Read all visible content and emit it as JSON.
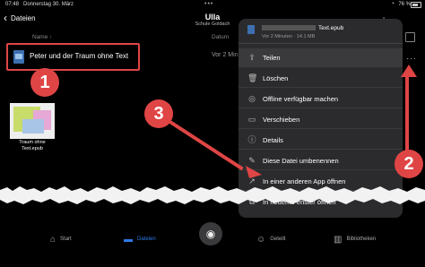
{
  "status": {
    "time": "07:48",
    "date": "Donnerstag 30. März",
    "battery": "76 %"
  },
  "header": {
    "back_label": "Dateien",
    "title": "Ulla",
    "subtitle": "Schule Goldach"
  },
  "columns": {
    "name": "Name",
    "date": "Datum"
  },
  "file": {
    "name": "Peter und der Traum ohne Text",
    "date": "Vor 2 Min"
  },
  "thumbnail": {
    "caption": "Traum ohne Text.epub"
  },
  "popover": {
    "file_name": "Text.epub",
    "file_meta": "Vor 2 Minuten · 14.1 MB",
    "items": [
      {
        "label": "Teilen",
        "icon": "share-icon"
      },
      {
        "label": "Löschen",
        "icon": "trash-icon"
      },
      {
        "label": "Offline verfügbar machen",
        "icon": "offline-icon"
      },
      {
        "label": "Verschieben",
        "icon": "move-icon"
      },
      {
        "label": "Details",
        "icon": "info-icon"
      },
      {
        "label": "Diese Datei umbenennen",
        "icon": "rename-icon"
      },
      {
        "label": "In einer anderen App öffnen",
        "icon": "open-in-app-icon"
      },
      {
        "label": "In neuem Fenster öffnen",
        "icon": "new-window-icon"
      }
    ]
  },
  "annotations": {
    "one": "1",
    "two": "2",
    "three": "3",
    "color": "#e04545"
  },
  "tabs": [
    {
      "label": "Start",
      "icon": "home-icon"
    },
    {
      "label": "Dateien",
      "icon": "folder-icon",
      "active": true
    },
    {
      "label": "Geteilt",
      "icon": "shared-icon"
    },
    {
      "label": "Bibliotheken",
      "icon": "libraries-icon"
    }
  ]
}
